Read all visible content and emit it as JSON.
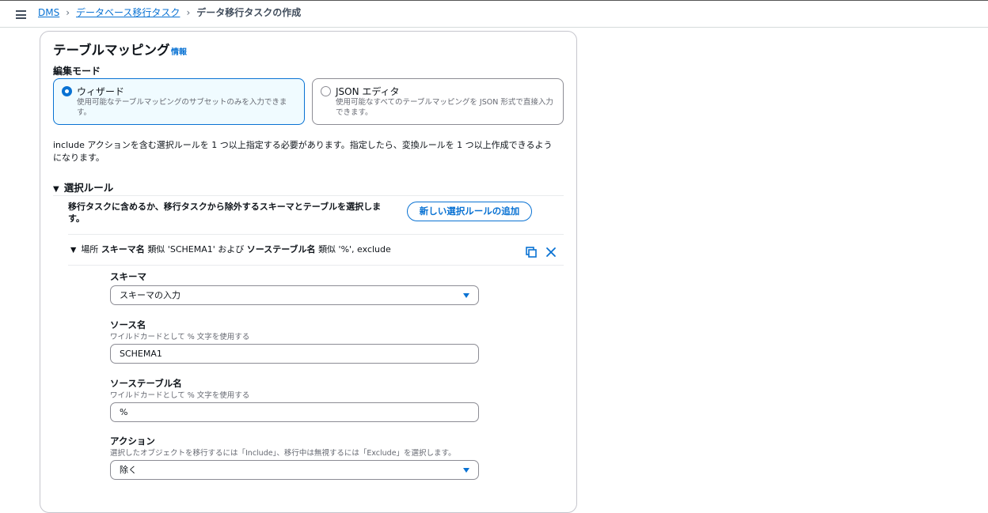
{
  "breadcrumb": {
    "items": [
      "DMS",
      "データベース移行タスク"
    ],
    "current": "データ移行タスクの作成"
  },
  "panel": {
    "title": "テーブルマッピング",
    "info_link": "情報",
    "edit_mode_label": "編集モード",
    "modes": [
      {
        "title": "ウィザード",
        "description": "使用可能なテーブルマッピングのサブセットのみを入力できます。",
        "selected": true
      },
      {
        "title": "JSON エディタ",
        "description": "使用可能なすべてのテーブルマッピングを JSON 形式で直接入力できます。",
        "selected": false
      }
    ],
    "notice": "include アクションを含む選択ルールを 1 つ以上指定する必要があります。指定したら、変換ルールを 1 つ以上作成できるようになります。"
  },
  "selection_rules": {
    "header": "選択ルール",
    "description": "移行タスクに含めるか、移行タスクから除外するスキーマとテーブルを選択します。",
    "add_button": "新しい選択ルールの追加",
    "rule": {
      "prefix": "場所",
      "schema_label": "スキーマ名",
      "similar1": "類似 'SCHEMA1' および",
      "table_label": "ソーステーブル名",
      "similar2": "類似 '%', exclude"
    },
    "fields": {
      "schema": {
        "label": "スキーマ",
        "value": "スキーマの入力"
      },
      "source_name": {
        "label": "ソース名",
        "hint": "ワイルドカードとして % 文字を使用する",
        "value": "SCHEMA1"
      },
      "source_table": {
        "label": "ソーステーブル名",
        "hint": "ワイルドカードとして % 文字を使用する",
        "value": "%"
      },
      "action": {
        "label": "アクション",
        "hint": "選択したオブジェクトを移行するには「Include」、移行中は無視するには「Exclude」を選択します。",
        "value": "除く"
      }
    }
  },
  "colors": {
    "accent": "#0972d3",
    "selected_tile_bg": "#f0fbff",
    "border": "#8c8c94"
  }
}
